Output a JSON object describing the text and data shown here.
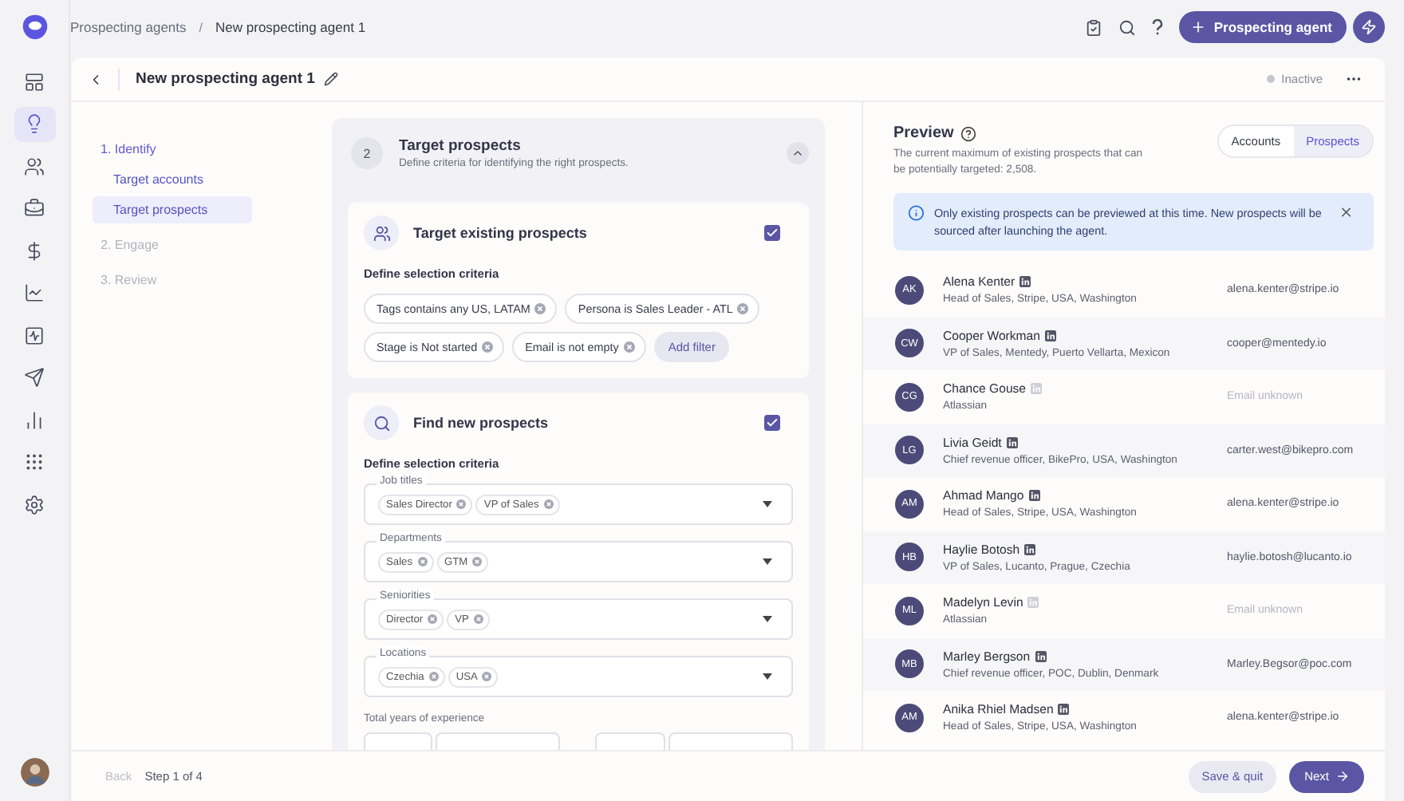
{
  "sidebar": {
    "items": [
      {
        "selected": false
      },
      {
        "selected": true
      },
      {
        "selected": false
      },
      {
        "selected": false
      },
      {
        "selected": false
      },
      {
        "selected": false
      },
      {
        "selected": false
      },
      {
        "selected": false
      },
      {
        "selected": false
      },
      {
        "selected": false
      },
      {
        "selected": false
      }
    ]
  },
  "breadcrumb": [
    "Prospecting agents",
    "New prospecting agent 1"
  ],
  "breadcrumb_separator": "/",
  "top_actions": {
    "primary_button": "Prospecting agent"
  },
  "header": {
    "title": "New prospecting agent 1",
    "status": "Inactive"
  },
  "steps": [
    {
      "label": "1. Identify",
      "disabled": false,
      "children": [
        {
          "label": "Target accounts",
          "selected": false
        },
        {
          "label": "Target prospects",
          "selected": true
        }
      ]
    },
    {
      "label": "2. Engage",
      "disabled": true
    },
    {
      "label": "3. Review",
      "disabled": true
    }
  ],
  "section": {
    "number": "2",
    "title": "Target prospects",
    "subtitle": "Define criteria for identifying the right prospects.",
    "expanded": true
  },
  "existing": {
    "title": "Target existing prospects",
    "checked": true,
    "criteria_label": "Define selection criteria",
    "filters": [
      "Tags contains any US, LATAM",
      "Persona is Sales Leader - ATL",
      "Stage is Not started",
      "Email is not empty"
    ],
    "add_filter": "Add filter"
  },
  "new": {
    "title": "Find new prospects",
    "checked": true,
    "criteria_label": "Define selection criteria",
    "fields": [
      {
        "label": "Job titles",
        "chips": [
          "Sales Director",
          "VP of Sales"
        ]
      },
      {
        "label": "Departments",
        "chips": [
          "Sales",
          "GTM"
        ]
      },
      {
        "label": "Seniorities",
        "chips": [
          "Director",
          "VP"
        ]
      },
      {
        "label": "Locations",
        "chips": [
          "Czechia",
          "USA"
        ]
      }
    ],
    "experience_label": "Total years of experience"
  },
  "preview": {
    "title": "Preview",
    "description": "The current maximum of existing prospects that can be potentially targeted: 2,508.",
    "tabs": [
      {
        "label": "Accounts",
        "selected": false
      },
      {
        "label": "Prospects",
        "selected": true
      }
    ],
    "alert": "Only existing prospects can be previewed at this time. New prospects will be sourced after launching the agent.",
    "prospects": [
      {
        "initials": "AK",
        "name": "Alena Kenter",
        "profile_linked": true,
        "detail": "Head of Sales, Stripe, USA, Washington",
        "email": "alena.kenter@stripe.io",
        "email_known": true
      },
      {
        "initials": "CW",
        "name": "Cooper Workman",
        "profile_linked": true,
        "detail": "VP of Sales, Mentedy, Puerto Vellarta, Mexicon",
        "email": "cooper@mentedy.io",
        "email_known": true
      },
      {
        "initials": "CG",
        "name": "Chance Gouse",
        "profile_linked": false,
        "detail": "Atlassian",
        "email": "Email unknown",
        "email_known": false
      },
      {
        "initials": "LG",
        "name": "Livia Geidt",
        "profile_linked": true,
        "detail": "Chief revenue officer, BikePro, USA, Washington",
        "email": "carter.west@bikepro.com",
        "email_known": true
      },
      {
        "initials": "AM",
        "name": "Ahmad Mango",
        "profile_linked": true,
        "detail": "Head of Sales, Stripe, USA, Washington",
        "email": "alena.kenter@stripe.io",
        "email_known": true
      },
      {
        "initials": "HB",
        "name": "Haylie Botosh",
        "profile_linked": true,
        "detail": "VP of Sales, Lucanto, Prague, Czechia",
        "email": "haylie.botosh@lucanto.io",
        "email_known": true
      },
      {
        "initials": "ML",
        "name": "Madelyn Levin",
        "profile_linked": false,
        "detail": "Atlassian",
        "email": "Email unknown",
        "email_known": false
      },
      {
        "initials": "MB",
        "name": "Marley Bergson",
        "profile_linked": true,
        "detail": "Chief revenue officer, POC, Dublin, Denmark",
        "email": "Marley.Begsor@poc.com",
        "email_known": true
      },
      {
        "initials": "AM",
        "name": "Anika Rhiel Madsen",
        "profile_linked": true,
        "detail": "Head of Sales, Stripe, USA, Washington",
        "email": "alena.kenter@stripe.io",
        "email_known": true
      }
    ]
  },
  "footer": {
    "back": "Back",
    "back_disabled": true,
    "step": "Step 1 of 4",
    "save": "Save & quit",
    "next": "Next"
  }
}
